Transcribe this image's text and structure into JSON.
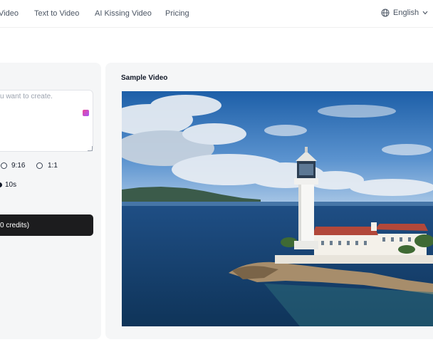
{
  "nav": {
    "items": [
      "Video",
      "Text to Video",
      "AI Kissing Video",
      "Pricing"
    ],
    "language": "English"
  },
  "form": {
    "prompt_placeholder": "u want to create.",
    "aspect_options": [
      "9:16",
      "1:1"
    ],
    "duration_option": "10s",
    "generate_label": "0 credits)"
  },
  "sample": {
    "title": "Sample Video"
  },
  "colors": {
    "button_bg": "#1c1c1e",
    "panel_bg": "#f5f6f7",
    "magic_icon": "#c026d3"
  }
}
